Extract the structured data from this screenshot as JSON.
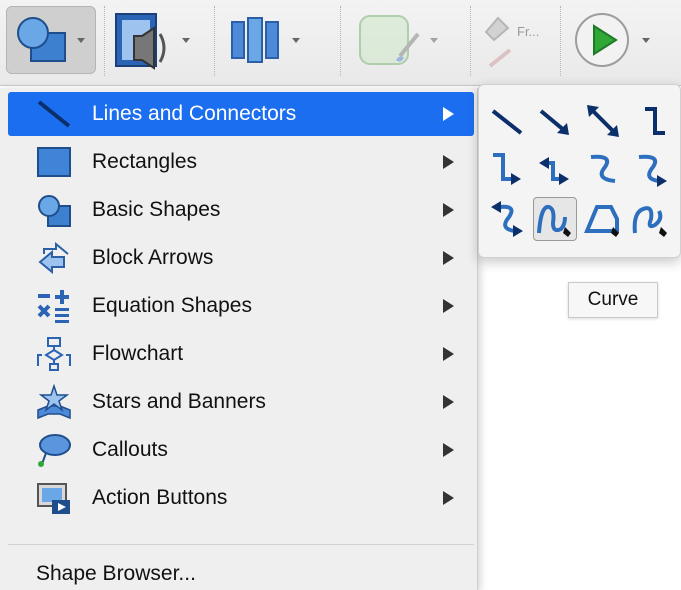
{
  "toolbar": {
    "buttons": [
      {
        "icon": "shapes-icon"
      },
      {
        "icon": "media-icon"
      },
      {
        "icon": "columns-icon"
      },
      {
        "icon": "fill-color-icon"
      },
      {
        "icon": "format-painter-icon"
      },
      {
        "icon": "play-icon"
      }
    ],
    "format_label": "Fr..."
  },
  "menu": {
    "items": [
      {
        "label": "Lines and Connectors",
        "icon": "line-icon",
        "active": true
      },
      {
        "label": "Rectangles",
        "icon": "rectangle-icon"
      },
      {
        "label": "Basic Shapes",
        "icon": "basic-shapes-icon"
      },
      {
        "label": "Block Arrows",
        "icon": "block-arrows-icon"
      },
      {
        "label": "Equation Shapes",
        "icon": "equation-shapes-icon"
      },
      {
        "label": "Flowchart",
        "icon": "flowchart-icon"
      },
      {
        "label": "Stars and Banners",
        "icon": "star-icon"
      },
      {
        "label": "Callouts",
        "icon": "callout-icon"
      },
      {
        "label": "Action Buttons",
        "icon": "action-button-icon"
      }
    ],
    "shape_browser": "Shape Browser..."
  },
  "submenu": {
    "icons": [
      "line",
      "arrow",
      "double-arrow",
      "elbow-connector",
      "elbow-arrow",
      "elbow-double-arrow",
      "curved-connector",
      "curved-arrow",
      "curved-double-arrow",
      "curve",
      "freeform",
      "scribble"
    ],
    "selected": "curve"
  },
  "tooltip": {
    "text": "Curve"
  },
  "colors": {
    "accent": "#1c6ef0",
    "connector_blue": "#2d6fbe"
  }
}
